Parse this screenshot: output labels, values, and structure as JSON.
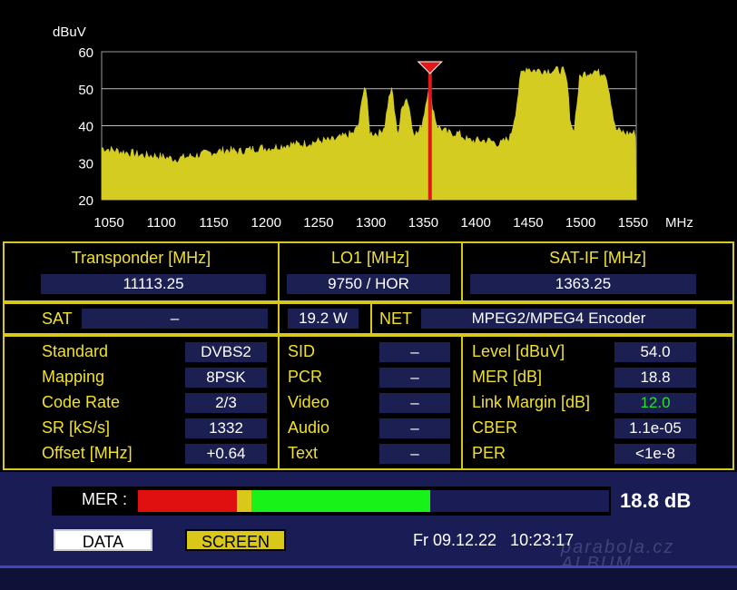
{
  "spectrum": {
    "y_unit": "dBuV",
    "x_unit": "MHz",
    "y_ticks": [
      "60",
      "50",
      "40",
      "30",
      "20"
    ],
    "x_ticks": [
      "1050",
      "1100",
      "1150",
      "1200",
      "1250",
      "1300",
      "1350",
      "1400",
      "1450",
      "1500",
      "1550"
    ],
    "marker_freq_mhz": 1363.25,
    "trace_color": "#d4cc20",
    "marker_color": "#e11818"
  },
  "chart_data": {
    "type": "area",
    "ylabel": "dBuV",
    "xlabel": "MHz",
    "xlim": [
      1050,
      1560
    ],
    "ylim": [
      20,
      60
    ],
    "grid": true,
    "x": [
      1050,
      1060,
      1070,
      1080,
      1090,
      1100,
      1110,
      1120,
      1130,
      1140,
      1150,
      1160,
      1170,
      1180,
      1190,
      1200,
      1210,
      1220,
      1230,
      1240,
      1250,
      1260,
      1270,
      1280,
      1290,
      1295,
      1298,
      1300,
      1302,
      1304,
      1306,
      1310,
      1315,
      1320,
      1323,
      1326,
      1328,
      1330,
      1333,
      1336,
      1340,
      1343,
      1346,
      1349,
      1352,
      1355,
      1358,
      1362,
      1366,
      1370,
      1375,
      1380,
      1390,
      1400,
      1410,
      1420,
      1430,
      1440,
      1445,
      1450,
      1453,
      1456,
      1460,
      1470,
      1480,
      1490,
      1494,
      1497,
      1500,
      1503,
      1506,
      1510,
      1520,
      1526,
      1530,
      1534,
      1540,
      1550,
      1560
    ],
    "series": [
      {
        "values": [
          34,
          33.5,
          33,
          32.5,
          32,
          32,
          31.5,
          31,
          31.5,
          32,
          32.5,
          33,
          33.5,
          33,
          33.5,
          34,
          34,
          34.5,
          35,
          35,
          35.5,
          36,
          36,
          37,
          38,
          40,
          46,
          51,
          50,
          44,
          38,
          38,
          38,
          40,
          46,
          50,
          48,
          42,
          38,
          44,
          48,
          46,
          40,
          38,
          38,
          40,
          44,
          51,
          45,
          40,
          39,
          38,
          38,
          36,
          36,
          36,
          35,
          37,
          44,
          54,
          55,
          56,
          55,
          55,
          55,
          55,
          52,
          42,
          38,
          45,
          53,
          54,
          55,
          54,
          55,
          50,
          39,
          38,
          38
        ]
      }
    ]
  },
  "panel": {
    "transponder_label": "Transponder [MHz]",
    "transponder_value": "11113.25",
    "lo1_label": "LO1 [MHz]",
    "lo1_value": "9750 / HOR",
    "satif_label": "SAT-IF [MHz]",
    "satif_value": "1363.25",
    "sat_label": "SAT",
    "sat_value": "–",
    "sat_position": "19.2 W",
    "net_label": "NET",
    "net_value": "MPEG2/MPEG4 Encoder",
    "left": [
      {
        "label": "Standard",
        "value": "DVBS2"
      },
      {
        "label": "Mapping",
        "value": "8PSK"
      },
      {
        "label": "Code Rate",
        "value": "2/3"
      },
      {
        "label": "SR [kS/s]",
        "value": "1332"
      },
      {
        "label": "Offset [MHz]",
        "value": "+0.64"
      }
    ],
    "middle": [
      {
        "label": "SID",
        "value": "–"
      },
      {
        "label": "PCR",
        "value": "–"
      },
      {
        "label": "Video",
        "value": "–"
      },
      {
        "label": "Audio",
        "value": "–"
      },
      {
        "label": "Text",
        "value": "–"
      }
    ],
    "right": [
      {
        "label": "Level [dBuV]",
        "value": "54.0"
      },
      {
        "label": "MER [dB]",
        "value": "18.8"
      },
      {
        "label": "Link Margin [dB]",
        "value": "12.0"
      },
      {
        "label": "CBER",
        "value": "1.1e-05"
      },
      {
        "label": "PER",
        "value": "<1e-8"
      }
    ]
  },
  "mer_bar": {
    "label": "MER :",
    "value_text": "18.8 dB",
    "fill_fraction": 0.62,
    "red_fraction": 0.21,
    "yellow_fraction": 0.03
  },
  "bottom": {
    "data_button": "DATA",
    "screen_button": "SCREEN",
    "datetime": "Fr 09.12.22   10:23:17",
    "watermark": "parabola.cz ALBUM"
  }
}
